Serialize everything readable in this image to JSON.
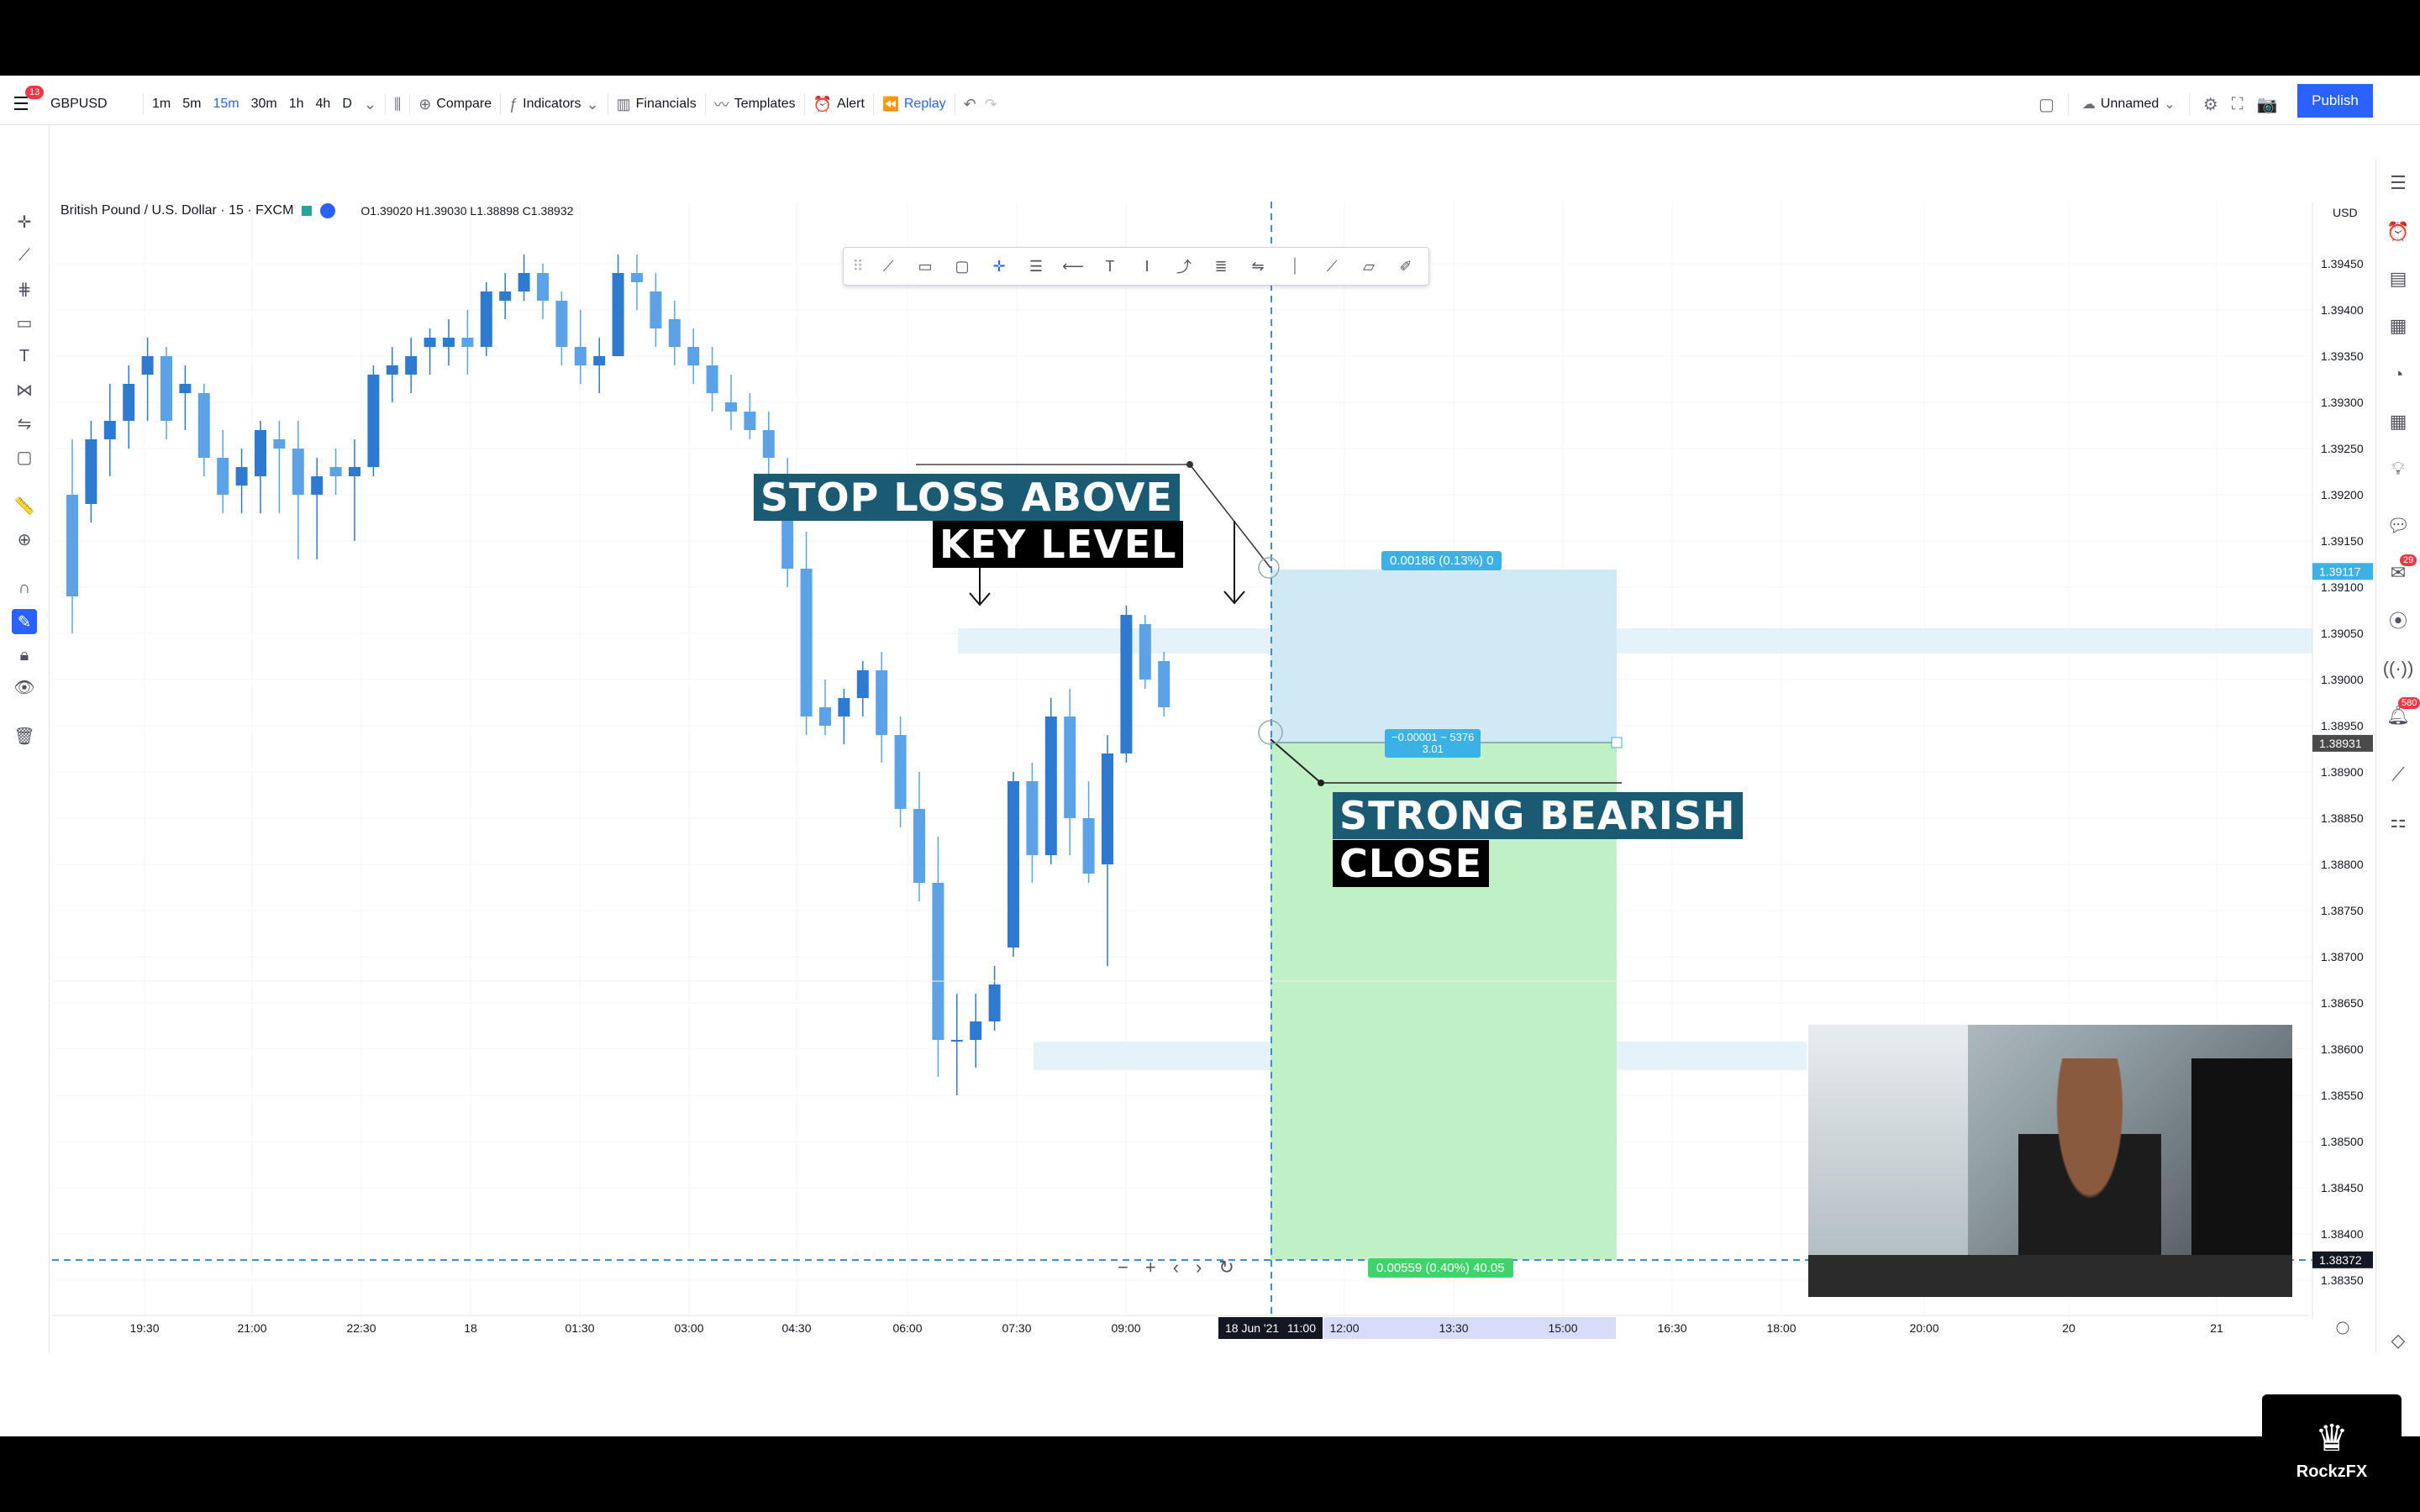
{
  "topbar": {
    "menu_badge": "13",
    "symbol": "GBPUSD",
    "intervals": [
      "1m",
      "5m",
      "15m",
      "30m",
      "1h",
      "4h",
      "D"
    ],
    "active_interval": "15m",
    "compare_label": "Compare",
    "indicators_label": "Indicators",
    "financials_label": "Financials",
    "templates_label": "Templates",
    "alert_label": "Alert",
    "replay_label": "Replay",
    "layout_name": "Unnamed",
    "publish_label": "Publish"
  },
  "legend": {
    "title": "British Pound / U.S. Dollar · 15 · FXCM",
    "ohlc": "O1.39020 H1.39030 L1.38898 C1.38932"
  },
  "price_axis": {
    "currency": "USD",
    "ticks": [
      "1.39450",
      "1.39400",
      "1.39350",
      "1.39300",
      "1.39250",
      "1.39200",
      "1.39150",
      "1.39100",
      "1.39050",
      "1.39000",
      "1.38950",
      "1.38900",
      "1.38850",
      "1.38800",
      "1.38750",
      "1.38700",
      "1.38650",
      "1.38600",
      "1.38550",
      "1.38500",
      "1.38450",
      "1.38400",
      "1.38350"
    ],
    "marker_top": "1.39117",
    "marker_current": "1.38931",
    "marker_bottom": "1.38372"
  },
  "time_axis": {
    "ticks": [
      "19:30",
      "21:00",
      "22:30",
      "18",
      "01:30",
      "03:00",
      "04:30",
      "06:00",
      "07:30",
      "09:00",
      "12:00",
      "13:30",
      "15:00",
      "16:30",
      "18:00",
      "20:00",
      "20",
      "21"
    ],
    "selected_date": "18 Jun '21",
    "selected_time": "11:00"
  },
  "position_tool": {
    "stop_label": "0.00186 (0.13%) 0",
    "entry_label_1": "−0.00001 ~ 5376",
    "entry_label_2": "3.01",
    "target_label": "0.00559 (0.40%) 40.05"
  },
  "annotations": {
    "stop_line1": "STOP LOSS ABOVE",
    "stop_line2": "KEY LEVEL",
    "bear_line1": "STRONG BEARISH",
    "bear_line2": "CLOSE"
  },
  "right_badges": {
    "notifications": "29",
    "alerts": "580"
  },
  "logo_text": "RockzFX",
  "colors": {
    "accent": "#2962ff",
    "candle_light": "#5ba3e6",
    "candle_dark": "#2f7ad1",
    "target_zone": "#bff0c6",
    "stop_zone": "#cfe9f5"
  }
}
